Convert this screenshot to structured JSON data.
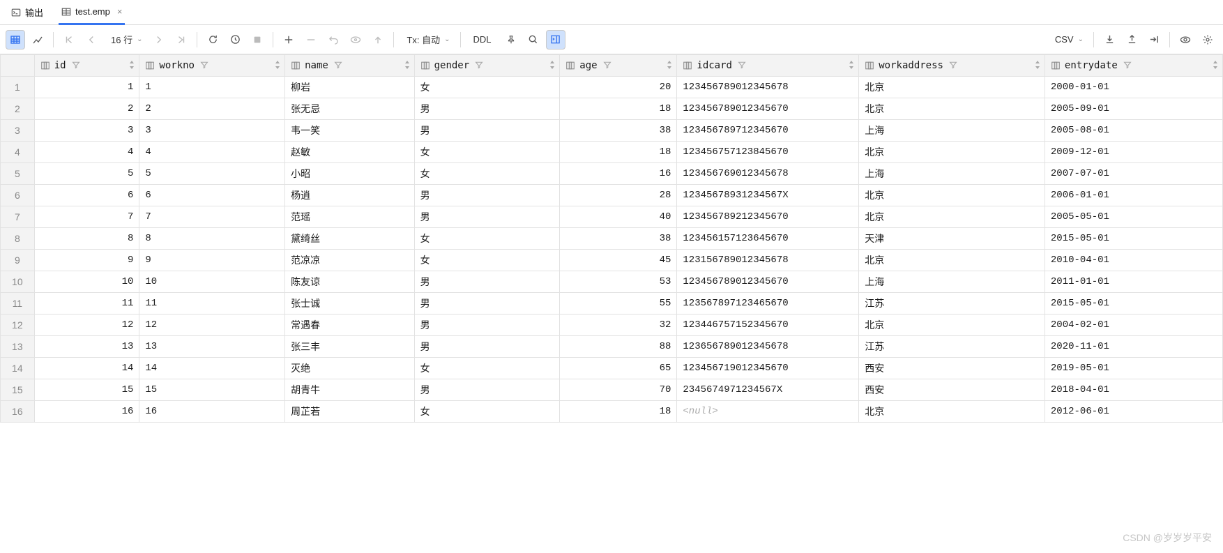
{
  "tabs": {
    "output": "输出",
    "file": "test.emp"
  },
  "toolbar": {
    "rows_label": "16 行",
    "tx_label": "Tx: 自动",
    "ddl": "DDL",
    "export": "CSV"
  },
  "columns": [
    "id",
    "workno",
    "name",
    "gender",
    "age",
    "idcard",
    "workaddress",
    "entrydate"
  ],
  "rows": [
    {
      "n": "1",
      "id": "1",
      "workno": "1",
      "name": "柳岩",
      "gender": "女",
      "age": "20",
      "idcard": "123456789012345678",
      "workaddress": "北京",
      "entrydate": "2000-01-01"
    },
    {
      "n": "2",
      "id": "2",
      "workno": "2",
      "name": "张无忌",
      "gender": "男",
      "age": "18",
      "idcard": "123456789012345670",
      "workaddress": "北京",
      "entrydate": "2005-09-01"
    },
    {
      "n": "3",
      "id": "3",
      "workno": "3",
      "name": "韦一笑",
      "gender": "男",
      "age": "38",
      "idcard": "123456789712345670",
      "workaddress": "上海",
      "entrydate": "2005-08-01"
    },
    {
      "n": "4",
      "id": "4",
      "workno": "4",
      "name": "赵敏",
      "gender": "女",
      "age": "18",
      "idcard": "123456757123845670",
      "workaddress": "北京",
      "entrydate": "2009-12-01"
    },
    {
      "n": "5",
      "id": "5",
      "workno": "5",
      "name": "小昭",
      "gender": "女",
      "age": "16",
      "idcard": "123456769012345678",
      "workaddress": "上海",
      "entrydate": "2007-07-01"
    },
    {
      "n": "6",
      "id": "6",
      "workno": "6",
      "name": "杨逍",
      "gender": "男",
      "age": "28",
      "idcard": "12345678931234567X",
      "workaddress": "北京",
      "entrydate": "2006-01-01"
    },
    {
      "n": "7",
      "id": "7",
      "workno": "7",
      "name": "范瑶",
      "gender": "男",
      "age": "40",
      "idcard": "123456789212345670",
      "workaddress": "北京",
      "entrydate": "2005-05-01"
    },
    {
      "n": "8",
      "id": "8",
      "workno": "8",
      "name": "黛绮丝",
      "gender": "女",
      "age": "38",
      "idcard": "123456157123645670",
      "workaddress": "天津",
      "entrydate": "2015-05-01"
    },
    {
      "n": "9",
      "id": "9",
      "workno": "9",
      "name": "范凉凉",
      "gender": "女",
      "age": "45",
      "idcard": "123156789012345678",
      "workaddress": "北京",
      "entrydate": "2010-04-01"
    },
    {
      "n": "10",
      "id": "10",
      "workno": "10",
      "name": "陈友谅",
      "gender": "男",
      "age": "53",
      "idcard": "123456789012345670",
      "workaddress": "上海",
      "entrydate": "2011-01-01"
    },
    {
      "n": "11",
      "id": "11",
      "workno": "11",
      "name": "张士诚",
      "gender": "男",
      "age": "55",
      "idcard": "123567897123465670",
      "workaddress": "江苏",
      "entrydate": "2015-05-01"
    },
    {
      "n": "12",
      "id": "12",
      "workno": "12",
      "name": "常遇春",
      "gender": "男",
      "age": "32",
      "idcard": "123446757152345670",
      "workaddress": "北京",
      "entrydate": "2004-02-01"
    },
    {
      "n": "13",
      "id": "13",
      "workno": "13",
      "name": "张三丰",
      "gender": "男",
      "age": "88",
      "idcard": "123656789012345678",
      "workaddress": "江苏",
      "entrydate": "2020-11-01"
    },
    {
      "n": "14",
      "id": "14",
      "workno": "14",
      "name": "灭绝",
      "gender": "女",
      "age": "65",
      "idcard": "123456719012345670",
      "workaddress": "西安",
      "entrydate": "2019-05-01"
    },
    {
      "n": "15",
      "id": "15",
      "workno": "15",
      "name": "胡青牛",
      "gender": "男",
      "age": "70",
      "idcard": "2345674971234567X",
      "workaddress": "西安",
      "entrydate": "2018-04-01"
    },
    {
      "n": "16",
      "id": "16",
      "workno": "16",
      "name": "周芷若",
      "gender": "女",
      "age": "18",
      "idcard": "<null>",
      "workaddress": "北京",
      "entrydate": "2012-06-01"
    }
  ],
  "watermark": "CSDN @岁岁岁平安"
}
